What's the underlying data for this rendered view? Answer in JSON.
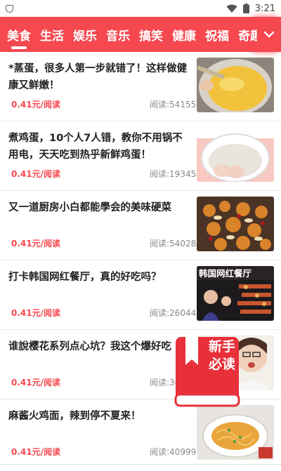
{
  "status_bar": {
    "time": "3:21",
    "icons": [
      "shield-icon",
      "wifi-icon",
      "battery-icon"
    ]
  },
  "tabs": [
    {
      "label": "美食",
      "active": true
    },
    {
      "label": "生活"
    },
    {
      "label": "娱乐"
    },
    {
      "label": "音乐"
    },
    {
      "label": "搞笑"
    },
    {
      "label": "健康"
    },
    {
      "label": "祝福"
    },
    {
      "label": "奇趣"
    }
  ],
  "colors": {
    "accent": "#f5484f",
    "earn_text": "#f5484f",
    "reads_text": "#888888"
  },
  "feed": [
    {
      "title": "*蒸蛋，很多人第一步就错了！这样做健康又鲜嫩！",
      "earn": "0.41元/阅读",
      "reads": "阅读:54155",
      "thumb": "steamed-egg-photo"
    },
    {
      "title": "煮鸡蛋，10个人7人错，教你不用锅不用电，天天吃到热乎新鲜鸡蛋！",
      "earn": "0.41元/阅读",
      "reads": "阅读:19345",
      "thumb": "boiled-eggs-bowl-photo"
    },
    {
      "title": "又一道厨房小白都能學会的美味硬菜",
      "earn": "0.41元/阅读",
      "reads": "阅读:54028",
      "thumb": "chicken-cashew-dish-photo"
    },
    {
      "title": "打卡韩国网红餐厅，真的好吃吗？",
      "earn": "0.41元/阅读",
      "reads": "阅读:26044",
      "thumb": "korean-restaurant-photo",
      "thumb_caption": "韩国网红餐厅"
    },
    {
      "title": "谁說樱花系列点心坑？我这个爆好吃",
      "earn": "0.41元/阅读",
      "reads": "阅读:36",
      "thumb": "woman-eating-photo"
    },
    {
      "title": "麻酱火鸡面，辣到停不夏来！",
      "earn": "0.41元/阅读",
      "reads": "阅读:40999",
      "thumb": "fire-noodles-photo"
    }
  ],
  "float_badge": {
    "text_line1": "新手",
    "text_line2": "必读"
  }
}
